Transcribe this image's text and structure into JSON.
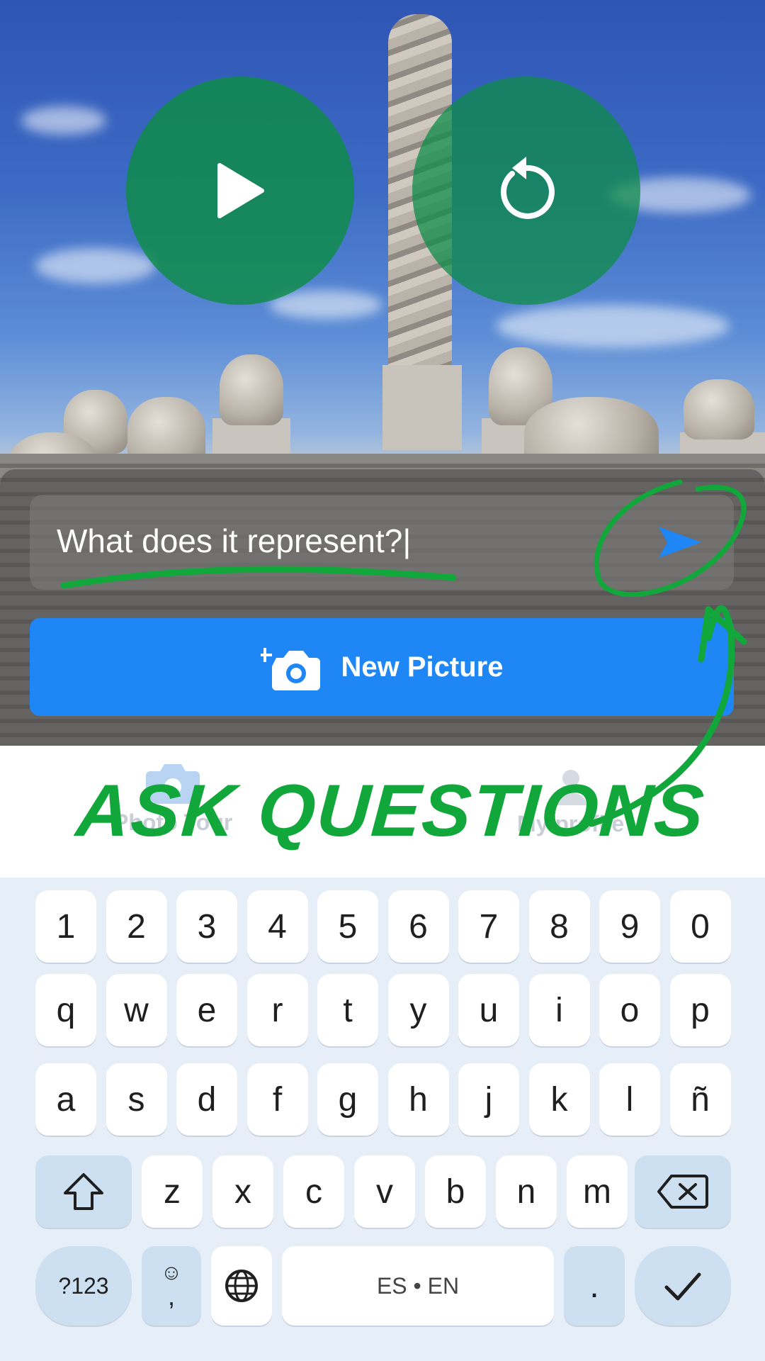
{
  "photo_controls": {
    "play_icon": "play-icon",
    "replay_icon": "replay-icon"
  },
  "question_input": {
    "value": "What does it represent?|",
    "send_icon": "send-icon"
  },
  "new_picture_button": {
    "label": "New Picture",
    "icon": "add-camera-icon"
  },
  "bottom_nav": {
    "items": [
      {
        "label": "Photo Tour",
        "icon": "camera-icon"
      },
      {
        "label": "My profile",
        "icon": "person-icon"
      }
    ]
  },
  "annotation": {
    "text": "ASK QUESTIONS",
    "color": "#11a73a"
  },
  "keyboard": {
    "row1": [
      "1",
      "2",
      "3",
      "4",
      "5",
      "6",
      "7",
      "8",
      "9",
      "0"
    ],
    "row2": [
      "q",
      "w",
      "e",
      "r",
      "t",
      "y",
      "u",
      "i",
      "o",
      "p"
    ],
    "row3": [
      "a",
      "s",
      "d",
      "f",
      "g",
      "h",
      "j",
      "k",
      "l",
      "ñ"
    ],
    "row4": [
      "z",
      "x",
      "c",
      "v",
      "b",
      "n",
      "m"
    ],
    "symbols_key": "?123",
    "comma_key": ",",
    "space_label": "ES • EN",
    "period_key": "."
  },
  "colors": {
    "accent_blue": "#1f86f5",
    "overlay_green": "#0e8c46",
    "keyboard_bg": "#e6eef8"
  }
}
